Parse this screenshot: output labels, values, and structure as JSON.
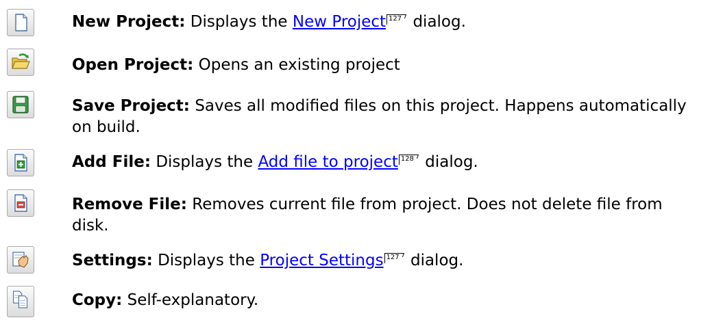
{
  "items": [
    {
      "icon": "new-document-icon",
      "title": "New Project:",
      "before": "Displays the ",
      "link": "New Project",
      "page": "127",
      "after": " dialog."
    },
    {
      "icon": "open-folder-icon",
      "title": "Open Project:",
      "text": "Opens an existing project"
    },
    {
      "icon": "floppy-disk-icon",
      "title": "Save Project:",
      "text": "Saves all modified files on this project. Happens automatically on build."
    },
    {
      "icon": "add-file-icon",
      "title": "Add File:",
      "before": "Displays the ",
      "link": "Add file to project",
      "page": "128",
      "after": " dialog."
    },
    {
      "icon": "remove-file-icon",
      "title": "Remove File:",
      "text": "Removes current file from project. Does not delete file from disk."
    },
    {
      "icon": "settings-hand-icon",
      "title": "Settings:",
      "before": "Displays the ",
      "link": "Project Settings",
      "page": "127",
      "after": " dialog."
    },
    {
      "icon": "copy-icon",
      "title": "Copy:",
      "text": "Self-explanatory."
    }
  ],
  "colors": {
    "link": "#0000ff",
    "text": "#000000"
  }
}
